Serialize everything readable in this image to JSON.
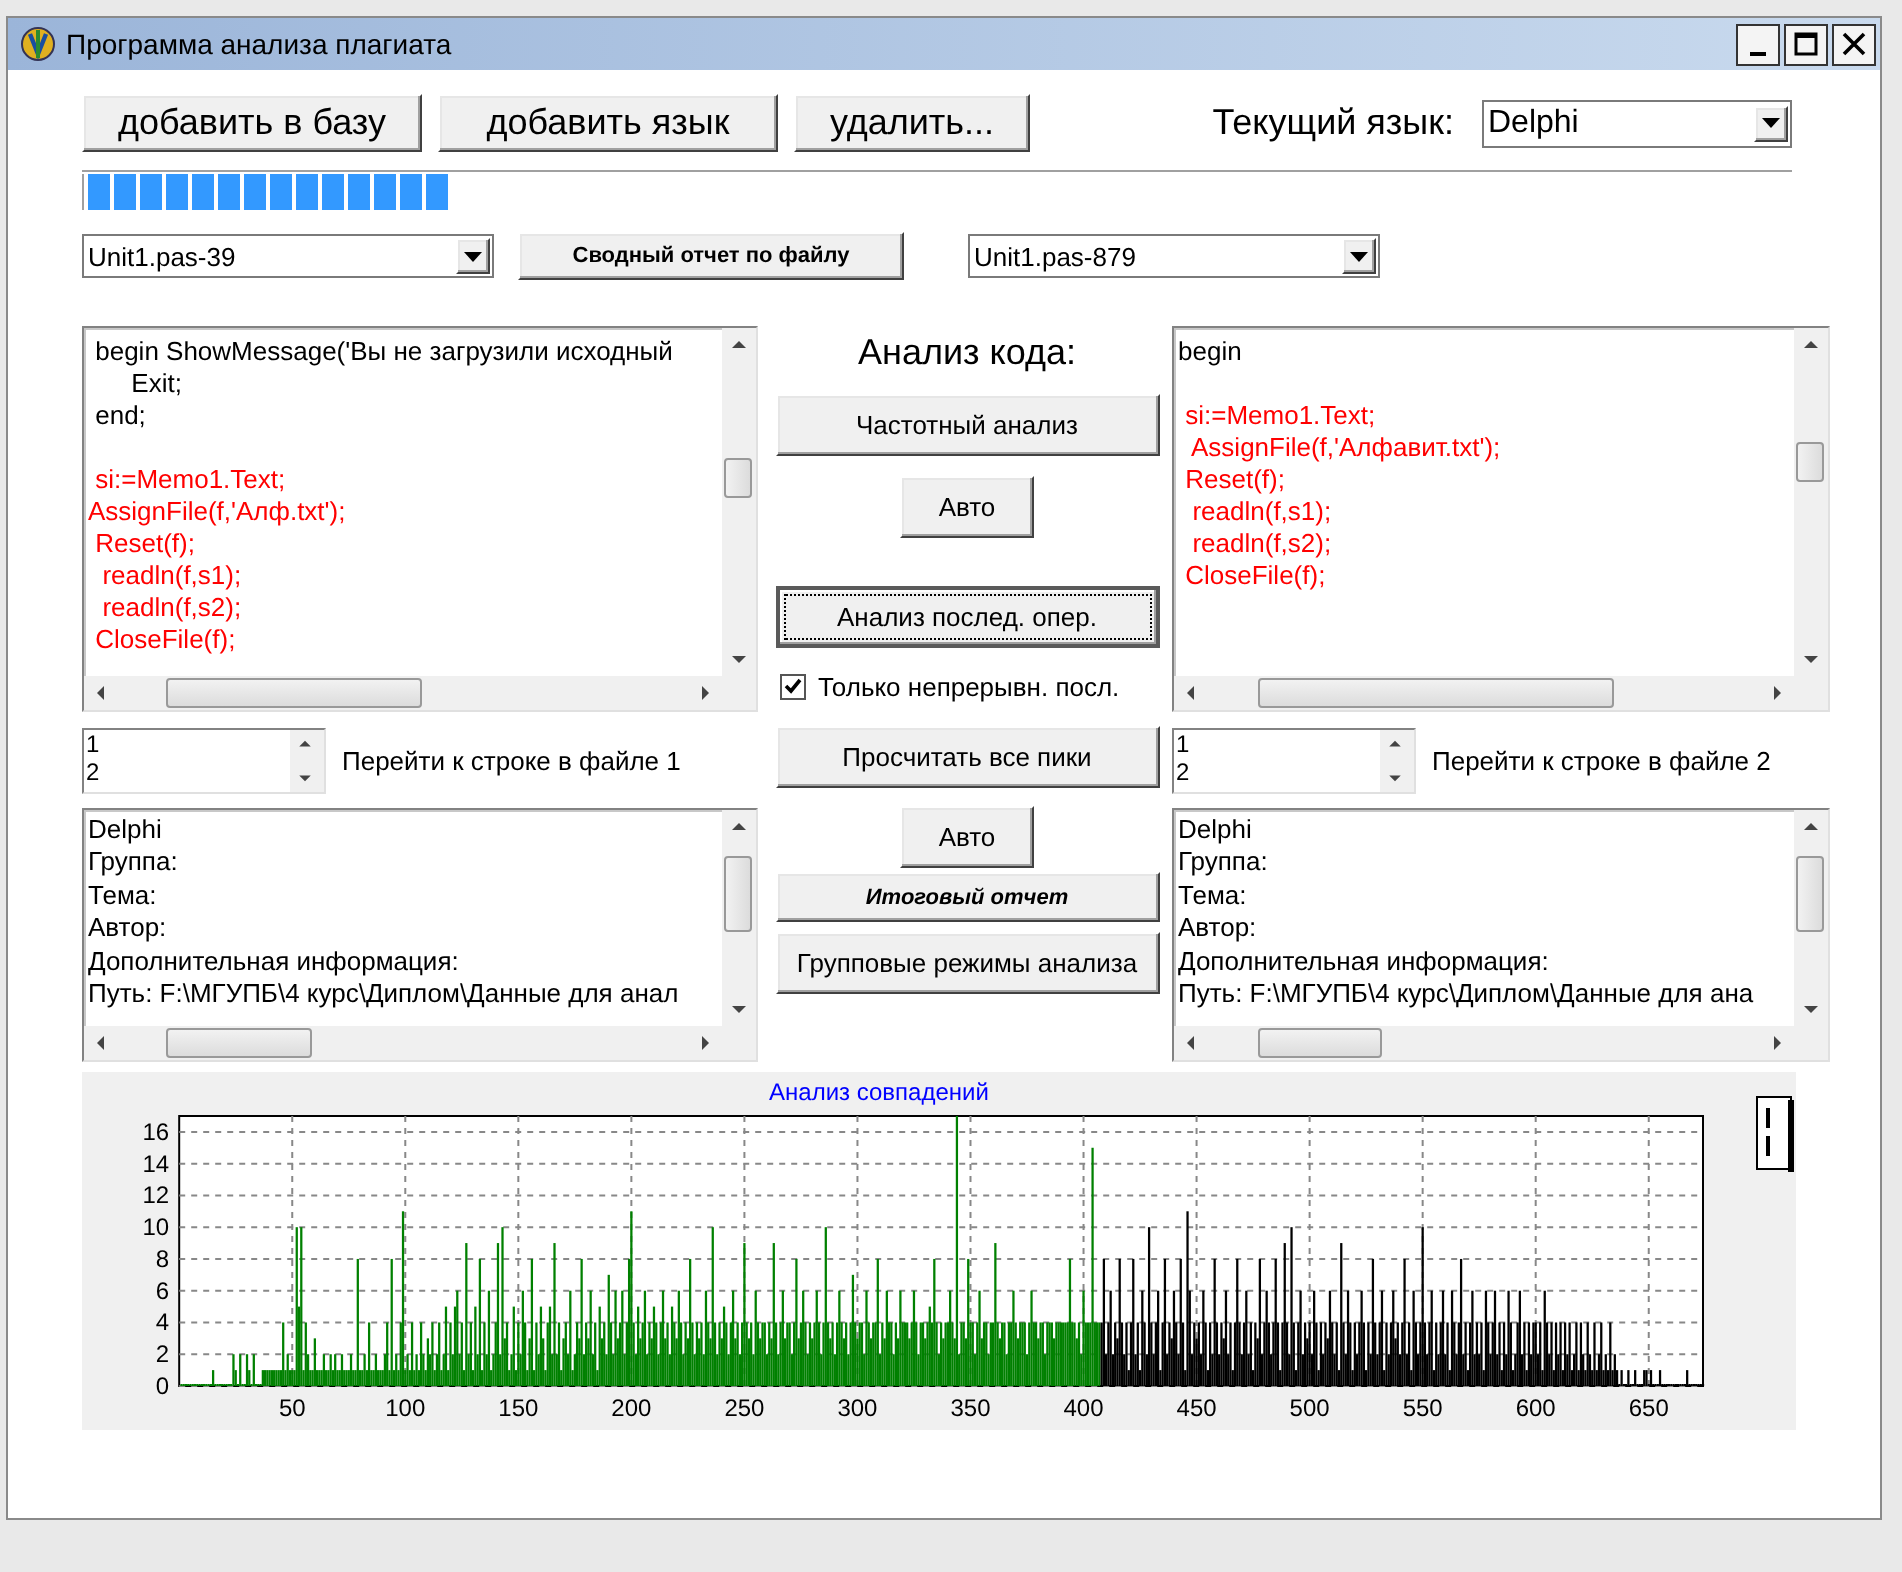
{
  "window": {
    "title": "Программа анализа плагиата"
  },
  "toolbar": {
    "buttons": [
      "добавить в базу",
      "добавить язык",
      "удалить..."
    ],
    "language_label": "Текущий язык:",
    "language": "Delphi"
  },
  "progress": {
    "level": 0.213
  },
  "file_row": {
    "left_file": "Unit1.pas-39",
    "report_button": "Сводный отчет по файлу",
    "right_file": "Unit1.pas-879"
  },
  "panels": [
    {
      "code_lines": [
        {
          "text": " begin ShowMessage('Вы не загрузили исходный",
          "highlighted": false,
          "gap_before": false
        },
        {
          "text": "      Exit;",
          "highlighted": false,
          "gap_before": false
        },
        {
          "text": " end;",
          "highlighted": false,
          "gap_before": false
        },
        {
          "text": " si:=Memo1.Text;",
          "highlighted": true,
          "gap_before": true
        },
        {
          "text": "AssignFile(f,'Алф.txt');",
          "highlighted": true,
          "gap_before": false
        },
        {
          "text": " Reset(f);",
          "highlighted": true,
          "gap_before": false
        },
        {
          "text": "  readln(f,s1);",
          "highlighted": true,
          "gap_before": false
        },
        {
          "text": "  readln(f,s2);",
          "highlighted": true,
          "gap_before": false
        },
        {
          "text": " CloseFile(f);",
          "highlighted": true,
          "gap_before": false
        }
      ],
      "line_list": [
        "1",
        "2"
      ],
      "goto_label": "Перейти к строке в файле 1",
      "info_lines": [
        "Delphi",
        "Группа:",
        "Тема:",
        "Автор:",
        "Дополнительная информация:",
        "Путь: F:\\МГУПБ\\4 курс\\Диплом\\Данные для анал"
      ]
    },
    {
      "code_lines": [
        {
          "text": "begin",
          "highlighted": false,
          "gap_before": false
        },
        {
          "text": " si:=Memo1.Text;",
          "highlighted": true,
          "gap_before": true
        },
        {
          "text": "  AssignFile(f,'Алфавит.txt');",
          "highlighted": true,
          "gap_before": false
        },
        {
          "text": " Reset(f);",
          "highlighted": true,
          "gap_before": false
        },
        {
          "text": "  readln(f,s1);",
          "highlighted": true,
          "gap_before": false
        },
        {
          "text": "  readln(f,s2);",
          "highlighted": true,
          "gap_before": false
        },
        {
          "text": " CloseFile(f);",
          "highlighted": true,
          "gap_before": false
        }
      ],
      "line_list": [
        "1",
        "2"
      ],
      "goto_label": "Перейти к строке в файле 2",
      "info_lines": [
        "Delphi",
        "Группа:",
        "Тема:",
        "Автор:",
        "Дополнительная информация:",
        "Путь: F:\\МГУПБ\\4 курс\\Диплом\\Данные для ана"
      ]
    }
  ],
  "analysis": {
    "heading": "Анализ кода:",
    "controls": [
      {
        "kind": "wide-button",
        "label": "Частотный анализ",
        "focused": false
      },
      {
        "kind": "small-button",
        "label": "Авто",
        "focused": false
      },
      {
        "kind": "wide-button",
        "label": "Анализ послед. опер.",
        "focused": true
      },
      {
        "kind": "checkbox",
        "label": "Только непрерывн. посл.",
        "checked": true
      },
      {
        "kind": "wide-button",
        "label": "Просчитать все пики",
        "focused": false
      },
      {
        "kind": "small-button",
        "label": "Авто",
        "focused": false
      },
      {
        "kind": "report-button",
        "label": "Итоговый отчет",
        "focused": false
      },
      {
        "kind": "wide-button",
        "label": "Групповые режимы анализа",
        "focused": false
      }
    ]
  },
  "chart": {
    "chart_data": {
      "type": "bar",
      "title": "Анализ совпадений",
      "grid": true,
      "xlim": [
        0,
        674
      ],
      "ylim": [
        0,
        17
      ],
      "xticks": [
        50,
        100,
        150,
        200,
        250,
        300,
        350,
        400,
        450,
        500,
        550,
        600,
        650
      ],
      "yticks": [
        0,
        2,
        4,
        6,
        8,
        10,
        12,
        14,
        16
      ],
      "x": [
        1,
        2,
        3,
        4,
        5,
        6,
        7,
        8,
        9,
        10,
        11,
        12,
        13,
        14,
        15,
        16,
        17,
        18,
        19,
        20,
        21,
        22,
        23,
        24,
        25,
        26,
        27,
        28,
        29,
        30,
        31,
        32,
        33,
        34,
        35,
        36,
        37,
        38,
        39,
        40,
        41,
        42,
        43,
        44,
        45,
        46,
        47,
        48,
        49,
        50,
        51,
        52,
        53,
        54,
        55,
        56,
        57,
        58,
        59,
        60,
        61,
        62,
        63,
        64,
        65,
        66,
        67,
        68,
        69,
        70,
        71,
        72,
        73,
        74,
        75,
        76,
        77,
        78,
        79,
        80,
        81,
        82,
        83,
        84,
        85,
        86,
        87,
        88,
        89,
        90,
        91,
        92,
        93,
        94,
        95,
        96,
        97,
        98,
        99,
        100,
        101,
        102,
        103,
        104,
        105,
        106,
        107,
        108,
        109,
        110,
        111,
        112,
        113,
        114,
        115,
        116,
        117,
        118,
        119,
        120,
        121,
        122,
        123,
        124,
        125,
        126,
        127,
        128,
        129,
        130,
        131,
        132,
        133,
        134,
        135,
        136,
        137,
        138,
        139,
        140,
        141,
        142,
        143,
        144,
        145,
        146,
        147,
        148,
        149,
        150,
        151,
        152,
        153,
        154,
        155,
        156,
        157,
        158,
        159,
        160,
        161,
        162,
        163,
        164,
        165,
        166,
        167,
        168,
        169,
        170,
        171,
        172,
        173,
        174,
        175,
        176,
        177,
        178,
        179,
        180,
        181,
        182,
        183,
        184,
        185,
        186,
        187,
        188,
        189,
        190,
        191,
        192,
        193,
        194,
        195,
        196,
        197,
        198,
        199,
        200,
        201,
        202,
        203,
        204,
        205,
        206,
        207,
        208,
        209,
        210,
        211,
        212,
        213,
        214,
        215,
        216,
        217,
        218,
        219,
        220,
        221,
        222,
        223,
        224,
        225,
        226,
        227,
        228,
        229,
        230,
        231,
        232,
        233,
        234,
        235,
        236,
        237,
        238,
        239,
        240,
        241,
        242,
        243,
        244,
        245,
        246,
        247,
        248,
        249,
        250,
        251,
        252,
        253,
        254,
        255,
        256,
        257,
        258,
        259,
        260,
        261,
        262,
        263,
        264,
        265,
        266,
        267,
        268,
        269,
        270,
        271,
        272,
        273,
        274,
        275,
        276,
        277,
        278,
        279,
        280,
        281,
        282,
        283,
        284,
        285,
        286,
        287,
        288,
        289,
        290,
        291,
        292,
        293,
        294,
        295,
        296,
        297,
        298,
        299,
        300,
        301,
        302,
        303,
        304,
        305,
        306,
        307,
        308,
        309,
        310,
        311,
        312,
        313,
        314,
        315,
        316,
        317,
        318,
        319,
        320,
        321,
        322,
        323,
        324,
        325,
        326,
        327,
        328,
        329,
        330,
        331,
        332,
        333,
        334,
        335,
        336,
        337,
        338,
        339,
        340,
        341,
        342,
        343,
        344,
        345,
        346,
        347,
        348,
        349,
        350,
        351,
        352,
        353,
        354,
        355,
        356,
        357,
        358,
        359,
        360,
        361,
        362,
        363,
        364,
        365,
        366,
        367,
        368,
        369,
        370,
        371,
        372,
        373,
        374,
        375,
        376,
        377,
        378,
        379,
        380,
        381,
        382,
        383,
        384,
        385,
        386,
        387,
        388,
        389,
        390,
        391,
        392,
        393,
        394,
        395,
        396,
        397,
        398,
        399,
        400,
        401,
        402,
        403,
        404,
        405,
        406,
        407,
        408,
        409,
        410,
        411,
        412,
        413,
        414,
        415,
        416,
        417,
        418,
        419,
        420,
        421,
        422,
        423,
        424,
        425,
        426,
        427,
        428,
        429,
        430,
        431,
        432,
        433,
        434,
        435,
        436,
        437,
        438,
        439,
        440,
        441,
        442,
        443,
        444,
        445,
        446,
        447,
        448,
        449,
        450,
        451,
        452,
        453,
        454,
        455,
        456,
        457,
        458,
        459,
        460,
        461,
        462,
        463,
        464,
        465,
        466,
        467,
        468,
        469,
        470,
        471,
        472,
        473,
        474,
        475,
        476,
        477,
        478,
        479,
        480,
        481,
        482,
        483,
        484,
        485,
        486,
        487,
        488,
        489,
        490,
        491,
        492,
        493,
        494,
        495,
        496,
        497,
        498,
        499,
        500,
        501,
        502,
        503,
        504,
        505,
        506,
        507,
        508,
        509,
        510,
        511,
        512,
        513,
        514,
        515,
        516,
        517,
        518,
        519,
        520,
        521,
        522,
        523,
        524,
        525,
        526,
        527,
        528,
        529,
        530,
        531,
        532,
        533,
        534,
        535,
        536,
        537,
        538,
        539,
        540,
        541,
        542,
        543,
        544,
        545,
        546,
        547,
        548,
        549,
        550,
        551,
        552,
        553,
        554,
        555,
        556,
        557,
        558,
        559,
        560,
        561,
        562,
        563,
        564,
        565,
        566,
        567,
        568,
        569,
        570,
        571,
        572,
        573,
        574,
        575,
        576,
        577,
        578,
        579,
        580,
        581,
        582,
        583,
        584,
        585,
        586,
        587,
        588,
        589,
        590,
        591,
        592,
        593,
        594,
        595,
        596,
        597,
        598,
        599,
        600,
        601,
        602,
        603,
        604,
        605,
        606,
        607,
        608,
        609,
        610,
        611,
        612,
        613,
        614,
        615,
        616,
        617,
        618,
        619,
        620,
        621,
        622,
        623,
        624,
        625,
        626,
        627,
        628,
        629,
        630,
        631,
        632,
        633,
        634,
        635,
        636,
        637,
        638,
        639,
        640,
        641,
        642,
        643,
        644,
        645,
        646,
        647,
        648,
        649,
        650,
        651,
        652,
        653,
        654,
        655,
        656,
        657,
        658,
        659,
        660,
        661,
        662,
        663,
        664,
        665,
        666,
        667,
        668,
        669,
        670,
        671,
        672,
        673,
        674
      ],
      "series": [
        {
          "color": "#008000",
          "values": [
            0,
            0,
            0,
            0,
            0,
            0,
            0,
            0,
            0,
            0,
            0,
            0,
            0,
            0,
            1,
            0,
            0,
            0,
            0,
            0,
            0,
            0,
            0,
            2,
            1,
            0,
            2,
            0,
            0,
            2,
            1,
            0,
            2,
            0,
            0,
            0,
            1,
            1,
            1,
            1,
            1,
            1,
            1,
            1,
            1,
            4,
            1,
            2,
            1,
            1,
            1,
            10,
            5,
            10,
            1,
            4,
            2,
            1,
            1,
            3,
            1,
            1,
            1,
            2,
            1,
            1,
            2,
            1,
            2,
            1,
            1,
            2,
            1,
            1,
            1,
            2,
            1,
            1,
            8,
            1,
            1,
            2,
            1,
            4,
            1,
            1,
            2,
            1,
            1,
            1,
            2,
            4,
            1,
            8,
            1,
            2,
            1,
            4,
            11,
            1,
            2,
            1,
            4,
            1,
            2,
            1,
            4,
            2,
            1,
            3,
            2,
            4,
            1,
            2,
            4,
            1,
            2,
            5,
            1,
            4,
            2,
            5,
            6,
            2,
            4,
            1,
            9,
            2,
            4,
            1,
            5,
            2,
            8,
            1,
            4,
            2,
            6,
            1,
            2,
            4,
            9,
            2,
            10,
            3,
            4,
            1,
            2,
            5,
            1,
            4,
            2,
            6,
            4,
            1,
            3,
            8,
            1,
            4,
            2,
            5,
            3,
            1,
            4,
            5,
            2,
            9,
            2,
            4,
            1,
            3,
            4,
            2,
            6,
            1,
            2,
            4,
            3,
            8,
            2,
            4,
            3,
            6,
            2,
            4,
            1,
            5,
            3,
            4,
            2,
            7,
            4,
            2,
            6,
            3,
            4,
            6,
            2,
            4,
            8,
            11,
            4,
            2,
            5,
            3,
            4,
            6,
            2,
            4,
            3,
            5,
            4,
            2,
            4,
            6,
            3,
            4,
            2,
            5,
            4,
            3,
            6,
            4,
            2,
            4,
            3,
            8,
            4,
            2,
            4,
            3,
            4,
            2,
            6,
            4,
            3,
            10,
            4,
            2,
            4,
            3,
            5,
            4,
            2,
            4,
            6,
            3,
            4,
            2,
            4,
            9,
            4,
            3,
            4,
            2,
            6,
            4,
            3,
            4,
            4,
            2,
            4,
            3,
            9,
            4,
            2,
            4,
            6,
            3,
            4,
            4,
            2,
            4,
            8,
            3,
            4,
            6,
            4,
            2,
            4,
            3,
            4,
            6,
            4,
            2,
            4,
            10,
            4,
            3,
            4,
            2,
            4,
            6,
            4,
            3,
            4,
            2,
            4,
            7,
            4,
            3,
            4,
            4,
            2,
            6,
            4,
            3,
            4,
            4,
            8,
            2,
            4,
            3,
            6,
            4,
            4,
            2,
            4,
            3,
            6,
            4,
            4,
            4,
            3,
            4,
            6,
            4,
            2,
            4,
            4,
            3,
            4,
            5,
            4,
            8,
            4,
            2,
            4,
            3,
            4,
            4,
            6,
            4,
            3,
            17,
            2,
            4,
            4,
            3,
            8,
            4,
            4,
            2,
            4,
            6,
            3,
            4,
            4,
            2,
            4,
            4,
            9,
            4,
            3,
            4,
            4,
            2,
            4,
            4,
            6,
            4,
            3,
            4,
            4,
            4,
            2,
            4,
            6,
            4,
            4,
            3,
            4,
            4,
            2,
            4,
            4,
            4,
            3,
            4,
            4,
            4,
            4,
            4,
            4,
            8,
            4,
            4,
            3,
            4,
            2,
            6,
            4,
            4,
            4,
            15,
            4,
            4,
            4,
            null,
            null,
            null,
            null,
            null,
            null,
            null,
            null,
            null,
            null,
            null,
            null,
            null,
            null,
            null,
            null,
            null,
            null,
            null,
            null,
            null,
            null,
            null,
            null,
            null,
            null,
            null,
            null,
            null,
            null,
            null,
            null,
            null,
            null,
            null,
            null,
            null,
            null,
            null,
            null,
            null,
            null,
            null,
            null,
            null,
            null,
            null,
            null,
            null,
            null,
            null,
            null,
            null,
            null,
            null,
            null,
            null,
            null,
            null,
            null,
            null,
            null,
            null,
            null,
            null,
            null,
            null,
            null,
            null,
            null,
            null,
            null,
            null,
            null,
            null,
            null,
            null,
            null,
            null,
            null,
            null,
            null,
            null,
            null,
            null,
            null,
            null,
            null,
            null,
            null,
            null,
            null,
            null,
            null,
            null,
            null,
            null,
            null,
            null,
            null,
            null,
            null,
            null,
            null,
            null,
            null,
            null,
            null,
            null,
            null,
            null,
            null,
            null,
            null,
            null,
            null,
            null,
            null,
            null,
            null,
            null,
            null,
            null,
            null,
            null,
            null,
            null,
            null,
            null,
            null,
            null,
            null,
            null,
            null,
            null,
            null,
            null,
            null,
            null,
            null,
            null,
            null,
            null,
            null,
            null,
            null,
            null,
            null,
            null,
            null,
            null,
            null,
            null,
            null,
            null,
            null,
            null,
            null,
            null,
            null,
            null,
            null,
            null,
            null,
            null,
            null,
            null,
            null,
            null,
            null,
            null,
            null,
            null,
            null,
            null,
            null,
            null,
            null,
            null,
            null,
            null,
            null,
            null,
            null,
            null,
            null,
            null,
            null,
            null,
            null,
            null,
            null,
            null,
            null,
            null,
            null,
            null,
            null,
            null,
            null,
            null,
            null,
            null,
            null,
            null,
            null,
            null,
            null,
            null,
            null,
            null,
            null,
            null,
            null,
            null,
            null,
            null,
            null,
            null,
            null,
            null,
            null,
            null,
            null,
            null,
            null,
            null,
            null,
            null,
            null,
            null,
            null,
            null,
            null,
            null,
            null,
            null,
            null,
            null,
            null,
            null,
            null,
            null,
            null,
            null,
            null,
            null,
            null,
            null,
            null,
            null,
            null,
            null,
            null,
            null,
            null,
            null,
            null,
            null,
            null,
            null,
            null,
            null,
            null,
            null,
            null,
            null
          ]
        },
        {
          "color": "#000000",
          "values": [
            null,
            null,
            null,
            null,
            null,
            null,
            null,
            null,
            null,
            null,
            null,
            null,
            null,
            null,
            null,
            null,
            null,
            null,
            null,
            null,
            null,
            null,
            null,
            null,
            null,
            null,
            null,
            null,
            null,
            null,
            null,
            null,
            null,
            null,
            null,
            null,
            null,
            null,
            null,
            null,
            null,
            null,
            null,
            null,
            null,
            null,
            null,
            null,
            null,
            null,
            null,
            null,
            null,
            null,
            null,
            null,
            null,
            null,
            null,
            null,
            null,
            null,
            null,
            null,
            null,
            null,
            null,
            null,
            null,
            null,
            null,
            null,
            null,
            null,
            null,
            null,
            null,
            null,
            null,
            null,
            null,
            null,
            null,
            null,
            null,
            null,
            null,
            null,
            null,
            null,
            null,
            null,
            null,
            null,
            null,
            null,
            null,
            null,
            null,
            null,
            null,
            null,
            null,
            null,
            null,
            null,
            null,
            null,
            null,
            null,
            null,
            null,
            null,
            null,
            null,
            null,
            null,
            null,
            null,
            null,
            null,
            null,
            null,
            null,
            null,
            null,
            null,
            null,
            null,
            null,
            null,
            null,
            null,
            null,
            null,
            null,
            null,
            null,
            null,
            null,
            null,
            null,
            null,
            null,
            null,
            null,
            null,
            null,
            null,
            null,
            null,
            null,
            null,
            null,
            null,
            null,
            null,
            null,
            null,
            null,
            null,
            null,
            null,
            null,
            null,
            null,
            null,
            null,
            null,
            null,
            null,
            null,
            null,
            null,
            null,
            null,
            null,
            null,
            null,
            null,
            null,
            null,
            null,
            null,
            null,
            null,
            null,
            null,
            null,
            null,
            null,
            null,
            null,
            null,
            null,
            null,
            null,
            null,
            null,
            null,
            null,
            null,
            null,
            null,
            null,
            null,
            null,
            null,
            null,
            null,
            null,
            null,
            null,
            null,
            null,
            null,
            null,
            null,
            null,
            null,
            null,
            null,
            null,
            null,
            null,
            null,
            null,
            null,
            null,
            null,
            null,
            null,
            null,
            null,
            null,
            null,
            null,
            null,
            null,
            null,
            null,
            null,
            null,
            null,
            null,
            null,
            null,
            null,
            null,
            null,
            null,
            null,
            null,
            null,
            null,
            null,
            null,
            null,
            null,
            null,
            null,
            null,
            null,
            null,
            null,
            null,
            null,
            null,
            null,
            null,
            null,
            null,
            null,
            null,
            null,
            null,
            null,
            null,
            null,
            null,
            null,
            null,
            null,
            null,
            null,
            null,
            null,
            null,
            null,
            null,
            null,
            null,
            null,
            null,
            null,
            null,
            null,
            null,
            null,
            null,
            null,
            null,
            null,
            null,
            null,
            null,
            null,
            null,
            null,
            null,
            null,
            null,
            null,
            null,
            null,
            null,
            null,
            null,
            null,
            null,
            null,
            null,
            null,
            null,
            null,
            null,
            null,
            null,
            null,
            null,
            null,
            null,
            null,
            null,
            null,
            null,
            null,
            null,
            null,
            null,
            null,
            null,
            null,
            null,
            null,
            null,
            null,
            null,
            null,
            null,
            null,
            null,
            null,
            null,
            null,
            null,
            null,
            null,
            null,
            null,
            null,
            null,
            null,
            null,
            null,
            null,
            null,
            null,
            null,
            null,
            null,
            null,
            null,
            null,
            null,
            null,
            null,
            null,
            null,
            null,
            null,
            null,
            null,
            null,
            null,
            null,
            null,
            null,
            null,
            null,
            null,
            null,
            null,
            null,
            null,
            null,
            null,
            null,
            null,
            null,
            null,
            null,
            null,
            null,
            null,
            null,
            null,
            4,
            8,
            2,
            4,
            6,
            2,
            4,
            3,
            8,
            4,
            2,
            4,
            1,
            4,
            8,
            2,
            4,
            1,
            6,
            4,
            2,
            10,
            4,
            2,
            4,
            6,
            1,
            4,
            8,
            2,
            4,
            3,
            6,
            4,
            2,
            8,
            4,
            1,
            11,
            6,
            2,
            4,
            3,
            4,
            2,
            6,
            4,
            1,
            4,
            2,
            8,
            4,
            2,
            4,
            3,
            6,
            2,
            4,
            1,
            4,
            8,
            4,
            2,
            4,
            6,
            2,
            4,
            1,
            4,
            3,
            8,
            2,
            4,
            6,
            4,
            2,
            4,
            8,
            4,
            1,
            4,
            9,
            4,
            2,
            10,
            4,
            1,
            4,
            6,
            2,
            4,
            3,
            4,
            2,
            6,
            4,
            1,
            4,
            2,
            4,
            3,
            6,
            4,
            2,
            4,
            1,
            9,
            4,
            2,
            6,
            4,
            1,
            4,
            2,
            4,
            6,
            4,
            1,
            4,
            2,
            8,
            4,
            2,
            4,
            6,
            1,
            4,
            2,
            4,
            6,
            3,
            4,
            2,
            4,
            8,
            2,
            4,
            1,
            6,
            4,
            2,
            4,
            10,
            4,
            2,
            4,
            6,
            1,
            4,
            2,
            4,
            6,
            2,
            4,
            1,
            6,
            4,
            2,
            4,
            8,
            2,
            4,
            1,
            4,
            6,
            2,
            4,
            2,
            4,
            1,
            6,
            4,
            2,
            4,
            6,
            2,
            4,
            1,
            4,
            2,
            6,
            4,
            1,
            2,
            4,
            6,
            2,
            4,
            1,
            4,
            2,
            4,
            4,
            2,
            4,
            1,
            6,
            4,
            2,
            4,
            1,
            4,
            2,
            4,
            1,
            4,
            2,
            4,
            1,
            2,
            4,
            1,
            4,
            2,
            1,
            4,
            2,
            1,
            4,
            1,
            2,
            4,
            1,
            2,
            1,
            4,
            1,
            2,
            1,
            0,
            1,
            0,
            0,
            1,
            0,
            0,
            1,
            0,
            0,
            0,
            1,
            1,
            0,
            1,
            0,
            0,
            0,
            1,
            0,
            0,
            0,
            0,
            0,
            0,
            0,
            0,
            0,
            0,
            0,
            1,
            0,
            0,
            0,
            0,
            0,
            0,
            0
          ]
        }
      ]
    }
  }
}
